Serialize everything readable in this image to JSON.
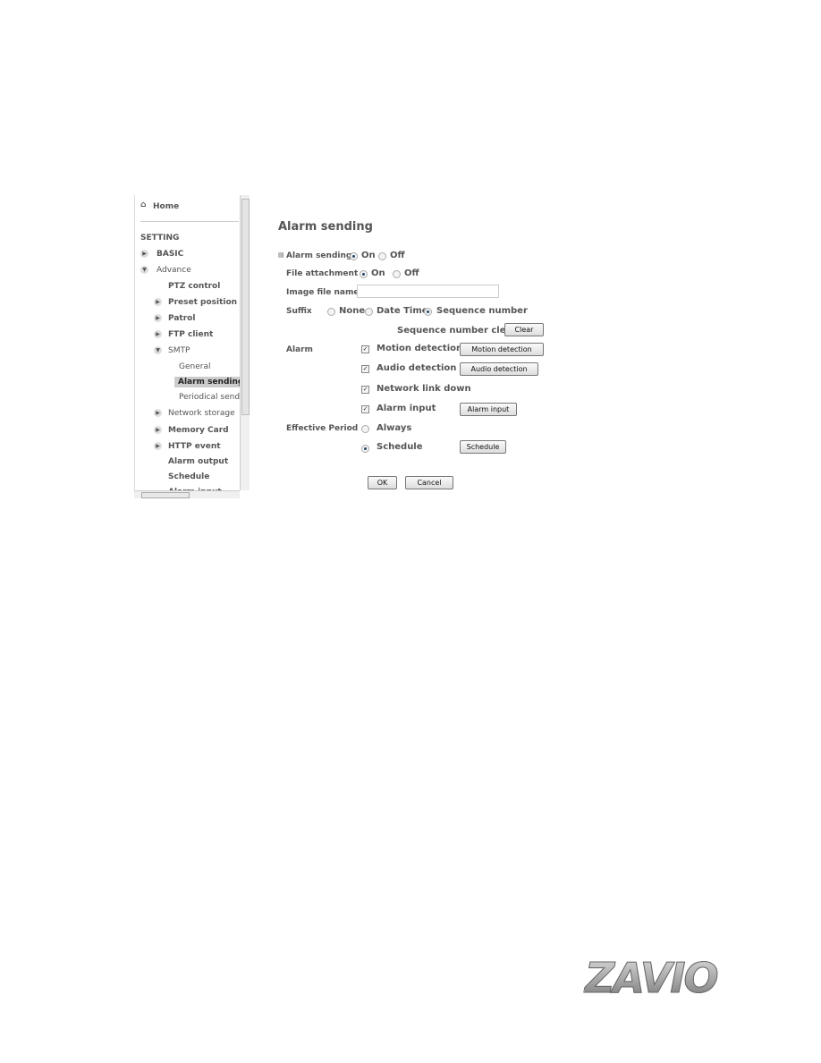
{
  "sidebar": {
    "home": "Home",
    "setting": "SETTING",
    "items": [
      {
        "label": "BASIC"
      },
      {
        "label": "Advance"
      },
      {
        "label": "PTZ control"
      },
      {
        "label": "Preset position"
      },
      {
        "label": "Patrol"
      },
      {
        "label": "FTP client"
      },
      {
        "label": "SMTP"
      },
      {
        "label": "General"
      },
      {
        "label": "Alarm sending"
      },
      {
        "label": "Periodical send"
      },
      {
        "label": "Network storage"
      },
      {
        "label": "Memory Card"
      },
      {
        "label": "HTTP event"
      },
      {
        "label": "Alarm output"
      },
      {
        "label": "Schedule"
      },
      {
        "label": "Alarm input"
      }
    ]
  },
  "main": {
    "title": "Alarm sending",
    "alarm_sending": {
      "label": "Alarm sending",
      "on": "On",
      "off": "Off",
      "selected": "On"
    },
    "file_attachment": {
      "label": "File attachment",
      "on": "On",
      "off": "Off",
      "selected": "On"
    },
    "image_file_name": {
      "label": "Image file name",
      "value": ""
    },
    "suffix": {
      "label": "Suffix",
      "options": [
        "None",
        "Date Time",
        "Sequence number"
      ],
      "selected": "Sequence number"
    },
    "seq_clear": {
      "label": "Sequence number clear",
      "button": "Clear"
    },
    "alarm": {
      "label": "Alarm",
      "items": [
        {
          "label": "Motion detection",
          "checked": true,
          "button": "Motion detection"
        },
        {
          "label": "Audio detection",
          "checked": true,
          "button": "Audio detection"
        },
        {
          "label": "Network link down",
          "checked": true
        },
        {
          "label": "Alarm input",
          "checked": true,
          "button": "Alarm input"
        }
      ]
    },
    "effective_period": {
      "label": "Effective Period",
      "always": "Always",
      "schedule": "Schedule",
      "selected": "Schedule",
      "button": "Schedule"
    },
    "ok": "OK",
    "cancel": "Cancel"
  },
  "logo": "ZAVIO"
}
